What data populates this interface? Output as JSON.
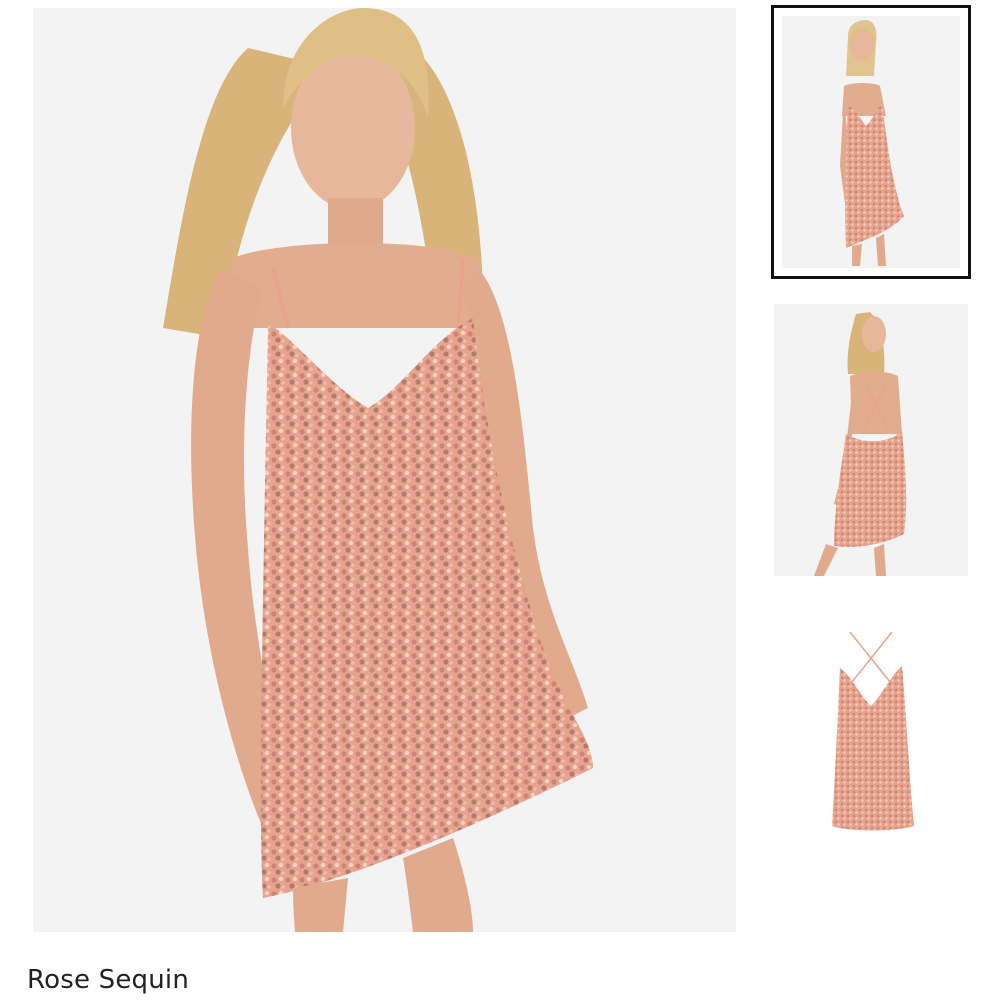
{
  "product": {
    "name": "Rose Sequin",
    "color_hex": "#e8a38e",
    "sequin_hex": "#c98574"
  },
  "gallery": {
    "main_image": "model-front-image",
    "thumbnails": [
      {
        "name": "thumbnail-model-front",
        "selected": true
      },
      {
        "name": "thumbnail-model-back",
        "selected": false
      },
      {
        "name": "thumbnail-dress-flat",
        "selected": false
      }
    ]
  }
}
